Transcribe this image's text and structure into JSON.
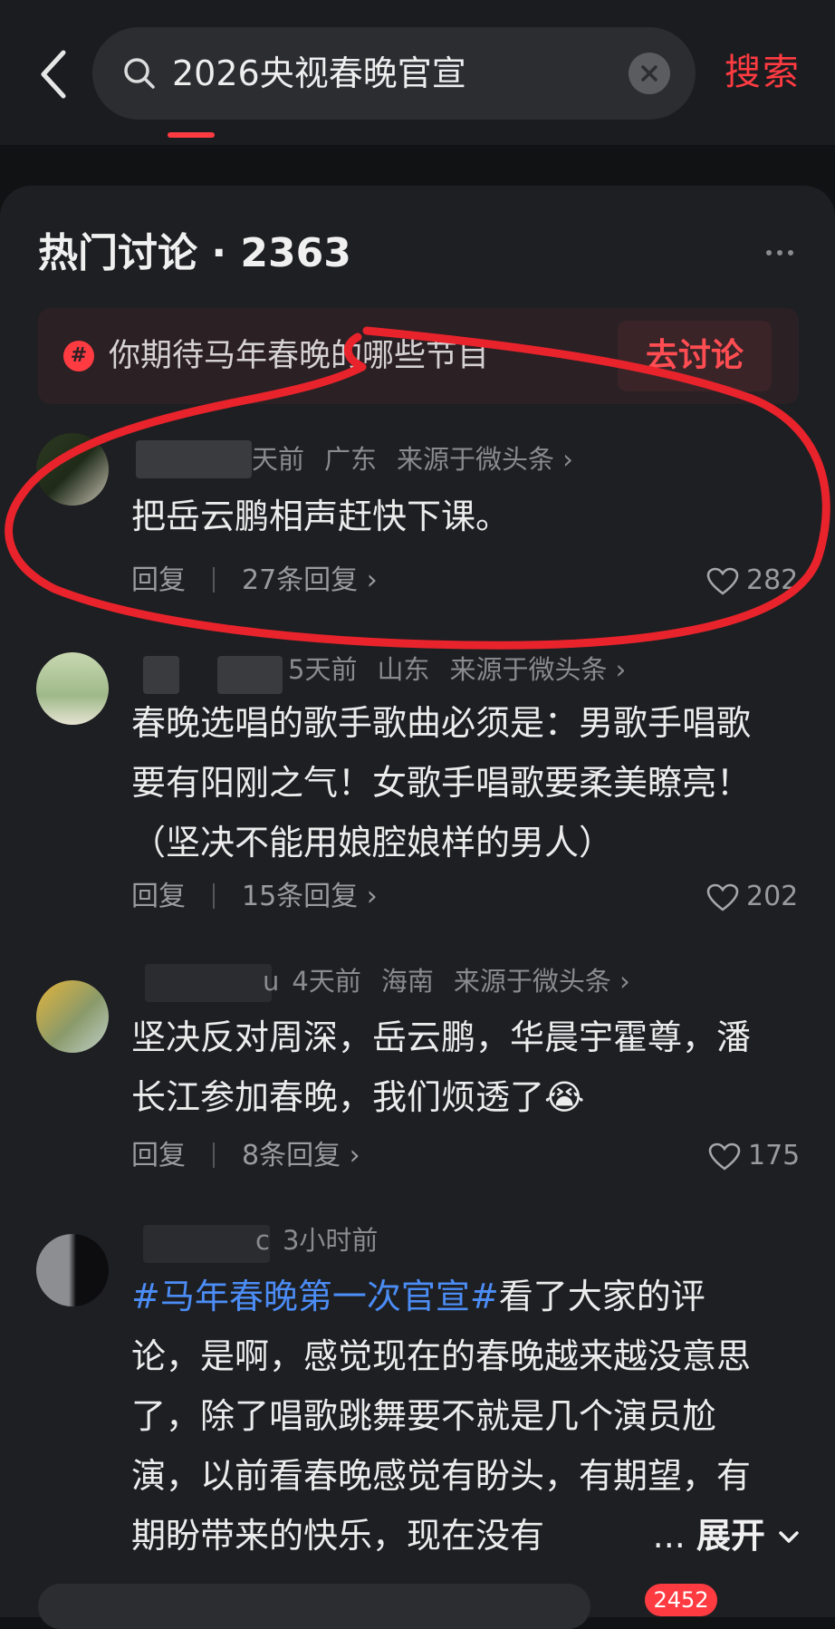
{
  "search": {
    "query": "2026央视春晚官宣",
    "submit_label": "搜索"
  },
  "section": {
    "title": "热门讨论 · 2363"
  },
  "topic_banner": {
    "text": "你期待马年春晚的哪些节目",
    "button_label": "去讨论"
  },
  "comments": [
    {
      "time": "天前",
      "location": "广东",
      "source": "来源于微头条 ›",
      "text": "把岳云鹏相声赶快下课。",
      "reply_label": "回复",
      "replies": "27条回复 ›",
      "likes": "282"
    },
    {
      "time": "5天前",
      "location": "山东",
      "source": "来源于微头条 ›",
      "text_lines": [
        "春晚选唱的歌手歌曲必须是：男歌手唱歌",
        "要有阳刚之气！女歌手唱歌要柔美瞭亮！",
        "（坚决不能用娘腔娘样的男人）"
      ],
      "reply_label": "回复",
      "replies": "15条回复 ›",
      "likes": "202"
    },
    {
      "name_tail": "u",
      "time": "4天前",
      "location": "海南",
      "source": "来源于微头条 ›",
      "text_lines": [
        "坚决反对周深，岳云鹏，华晨宇霍尊，潘",
        "长江参加春晚，我们烦透了😭"
      ],
      "reply_label": "回复",
      "replies": "8条回复 ›",
      "likes": "175"
    },
    {
      "name_tail": "c",
      "time": "3小时前",
      "hashtag": "#马年春晚第一次官宣#",
      "text_first": "看了大家的评",
      "text_lines": [
        "论，是啊，感觉现在的春晚越来越没意思",
        "了，除了唱歌跳舞要不就是几个演员尬",
        "演，以前看春晚感觉有盼头，有期望，有",
        "期盼带来的快乐，现在没有"
      ],
      "ellipsis": "...",
      "expand_label": "展开"
    }
  ],
  "bottom": {
    "badge": "2452"
  },
  "colors": {
    "accent": "#ff3b42",
    "hashtag": "#4b8cf5",
    "annotation": "#e8232b"
  },
  "icons": [
    "back-arrow-icon",
    "search-icon",
    "clear-icon",
    "more-icon",
    "topic-hash-icon",
    "heart-icon",
    "chevron-down-icon"
  ]
}
